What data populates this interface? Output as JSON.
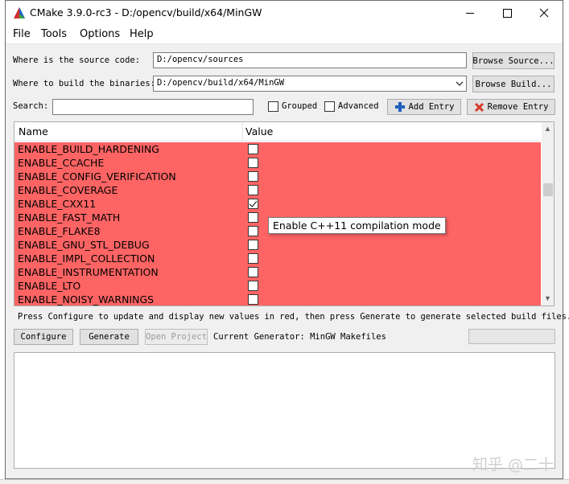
{
  "window": {
    "title": "CMake 3.9.0-rc3 - D:/opencv/build/x64/MinGW"
  },
  "menu": {
    "items": [
      "File",
      "Tools",
      "Options",
      "Help"
    ]
  },
  "source": {
    "label": "Where is the source code:",
    "value": "D:/opencv/sources",
    "browse_label": "Browse Source..."
  },
  "build": {
    "label": "Where to build the binaries:",
    "value": "D:/opencv/build/x64/MinGW",
    "browse_label": "Browse Build..."
  },
  "search": {
    "label": "Search:",
    "value": "",
    "grouped_label": "Grouped",
    "advanced_label": "Advanced",
    "add_entry_label": "Add Entry",
    "remove_entry_label": "Remove Entry"
  },
  "table": {
    "name_header": "Name",
    "value_header": "Value",
    "row_color": "#ff6464",
    "rows": [
      {
        "name": "ENABLE_BUILD_HARDENING",
        "checked": false
      },
      {
        "name": "ENABLE_CCACHE",
        "checked": false
      },
      {
        "name": "ENABLE_CONFIG_VERIFICATION",
        "checked": false
      },
      {
        "name": "ENABLE_COVERAGE",
        "checked": false
      },
      {
        "name": "ENABLE_CXX11",
        "checked": true
      },
      {
        "name": "ENABLE_FAST_MATH",
        "checked": false
      },
      {
        "name": "ENABLE_FLAKE8",
        "checked": false
      },
      {
        "name": "ENABLE_GNU_STL_DEBUG",
        "checked": false
      },
      {
        "name": "ENABLE_IMPL_COLLECTION",
        "checked": false
      },
      {
        "name": "ENABLE_INSTRUMENTATION",
        "checked": false
      },
      {
        "name": "ENABLE_LTO",
        "checked": false
      },
      {
        "name": "ENABLE_NOISY_WARNINGS",
        "checked": false
      }
    ]
  },
  "tooltip": {
    "text": "Enable C++11 compilation mode"
  },
  "status": {
    "hint": "Press Configure to update and display new values in red, then press Generate to generate selected build files."
  },
  "actions": {
    "configure_label": "Configure",
    "generate_label": "Generate",
    "open_project_label": "Open Project",
    "generator_text": "Current Generator: MinGW Makefiles"
  },
  "output": {
    "text": ""
  },
  "watermark": {
    "text": "知乎 @二十"
  },
  "icons": {
    "app": "cmake-triangle-icon",
    "add": "plus-icon",
    "remove": "x-icon"
  },
  "colors": {
    "accent_blue": "#1f5fbf",
    "remove_red": "#d93a2b"
  }
}
